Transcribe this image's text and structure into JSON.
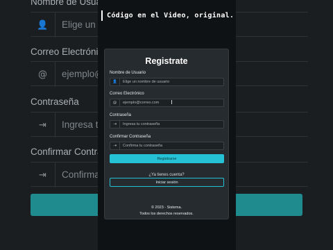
{
  "caption": "Código en el Video, original.",
  "background": {
    "labels": [
      "Nombre de Usuario",
      "Correo Electrónico",
      "Contraseña",
      "Confirmar Contraseña"
    ],
    "fields": [
      {
        "icon": "user-icon",
        "text": "Elige un nombre de usuario"
      },
      {
        "icon": "at-icon",
        "text": "ejemplo@correo.com"
      },
      {
        "icon": "key-icon",
        "text": "Ingresa tu contraseña"
      },
      {
        "icon": "key-icon",
        "text": "Confirma tu contraseña"
      }
    ]
  },
  "form": {
    "title": "Registrate",
    "fields": [
      {
        "label": "Nombre de Usuario",
        "icon": "user-icon",
        "glyph": "👤",
        "placeholder": "Elige un nombre de usuario"
      },
      {
        "label": "Correo Electrónico",
        "icon": "at-icon",
        "glyph": "@",
        "placeholder": "ejemplo@correo.com"
      },
      {
        "label": "Contraseña",
        "icon": "key-icon",
        "glyph": "⇥",
        "placeholder": "Ingresa tu contraseña"
      },
      {
        "label": "Confirmar Contraseña",
        "icon": "key-icon",
        "glyph": "⇥",
        "placeholder": "Confirma tu contraseña"
      }
    ],
    "submit_label": "Registrarse",
    "question": "¿Ya tienes cuenta?",
    "login_label": "Iniciar sesión"
  },
  "footer": {
    "line1": "© 2023 - Sistema.",
    "line2": "Todos los derechos reservados."
  },
  "colors": {
    "accent": "#25c2d6",
    "card": "#252b2f",
    "background": "#1a1e21"
  }
}
